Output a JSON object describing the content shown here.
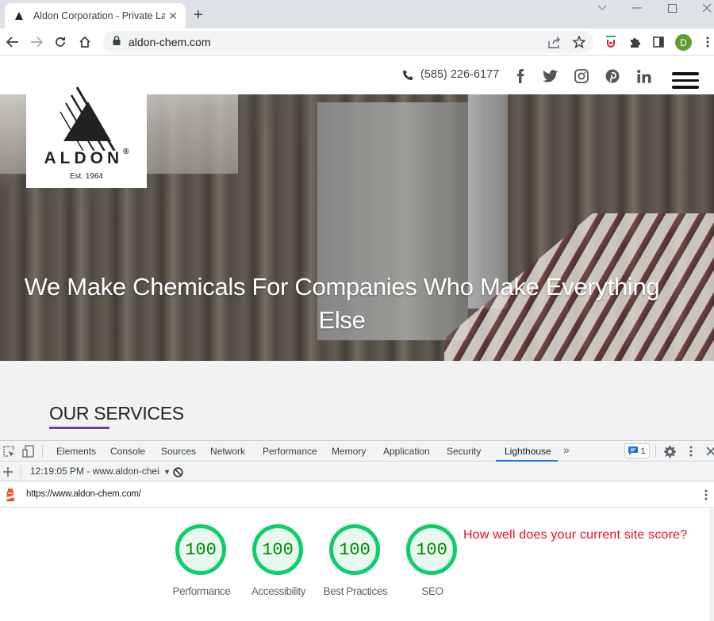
{
  "browser": {
    "tab": {
      "title": "Aldon Corporation - Private Label",
      "close_icon": "close-icon",
      "favicon": "aldon-triangle-icon"
    },
    "new_tab_icon": "plus-icon",
    "window_controls": [
      "tab-search-icon",
      "minimize-icon",
      "maximize-icon",
      "close-icon"
    ],
    "nav": [
      "back-icon",
      "forward-icon",
      "reload-icon",
      "home-icon"
    ],
    "address": {
      "lock_icon": "lock-icon",
      "url": "aldon-chem.com"
    },
    "omnibox_actions": [
      "share-icon",
      "bookmark-star-icon"
    ],
    "extensions": [
      "extension-shield-icon",
      "puzzle-icon",
      "side-panel-icon"
    ],
    "profile_initial": "D",
    "menu_icon": "kebab-menu-icon"
  },
  "site": {
    "logo": {
      "wordmark": "ALDON",
      "registered": "®",
      "established": "Est. 1964"
    },
    "header": {
      "phone": "(585) 226-6177",
      "social": [
        "facebook",
        "twitter",
        "instagram",
        "pinterest",
        "linkedin"
      ]
    },
    "hero": {
      "title": "We Make Chemicals For Companies Who Make Everything Else"
    },
    "services": {
      "title": "OUR SERVICES"
    }
  },
  "devtools": {
    "tabs": [
      {
        "label": "Elements"
      },
      {
        "label": "Console"
      },
      {
        "label": "Sources"
      },
      {
        "label": "Network"
      },
      {
        "label": "Performance"
      },
      {
        "label": "Memory"
      },
      {
        "label": "Application"
      },
      {
        "label": "Security"
      },
      {
        "label": "Lighthouse",
        "active": true
      }
    ],
    "more_tabs": "»",
    "issues_count": "1",
    "report": {
      "label": "12:19:05 PM - www.aldon-chei",
      "url": "https://www.aldon-chem.com/"
    },
    "scores": [
      {
        "value": "100",
        "label": "Performance"
      },
      {
        "value": "100",
        "label": "Accessibility"
      },
      {
        "value": "100",
        "label": "Best Practices"
      },
      {
        "value": "100",
        "label": "SEO"
      }
    ],
    "score_color": "#0cce6b",
    "promo_text": "How well does your current site score?",
    "promo_color": "#e8101a"
  }
}
